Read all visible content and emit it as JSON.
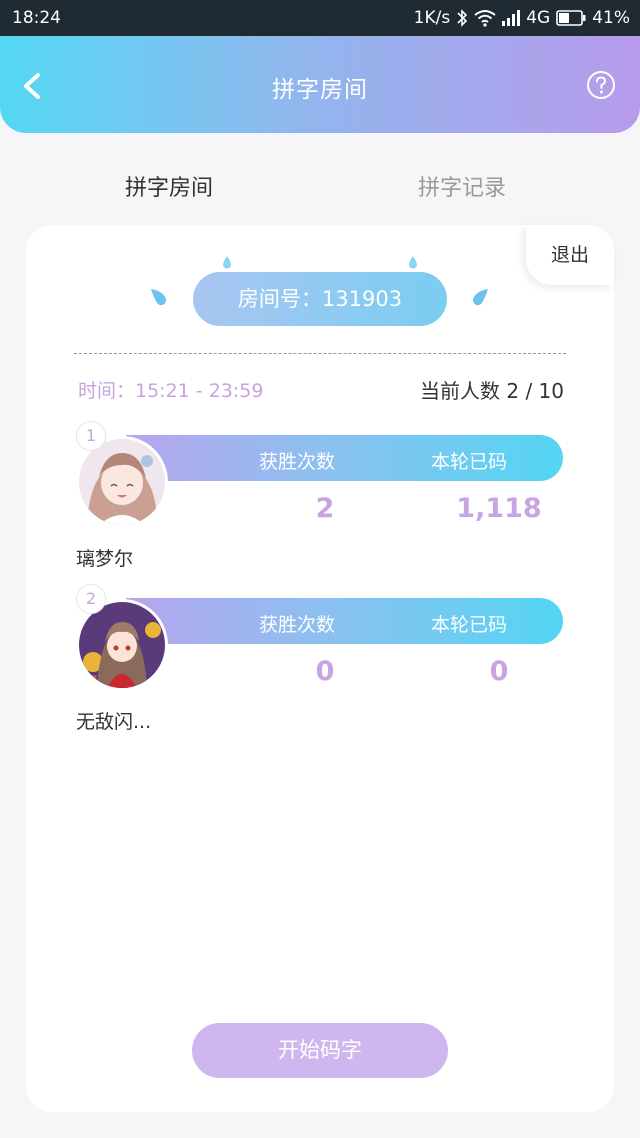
{
  "status_bar": {
    "time": "18:24",
    "net_speed": "1K/s",
    "network": "4G",
    "battery": "41%"
  },
  "header": {
    "title": "拼字房间",
    "back_icon": "chevron-left-icon",
    "help_icon": "question-circle-icon"
  },
  "tabs": [
    {
      "label": "拼字房间",
      "active": true
    },
    {
      "label": "拼字记录",
      "active": false
    }
  ],
  "room": {
    "exit_label": "退出",
    "room_label": "房间号：131903",
    "time_label": "时间：15:21 - 23:59",
    "count_label": "当前人数 2 / 10"
  },
  "stat_labels": {
    "wins": "获胜次数",
    "typed": "本轮已码"
  },
  "players": [
    {
      "rank": "1",
      "name": "璃梦尔",
      "wins": "2",
      "typed": "1,118"
    },
    {
      "rank": "2",
      "name": "无敌闪...",
      "wins": "0",
      "typed": "0"
    }
  ],
  "start_button": "开始码字",
  "colors": {
    "header_start": "#54d8f2",
    "header_end": "#b79bea",
    "accent_purple": "#c9a4e4",
    "start_button": "#d0b6ee"
  }
}
